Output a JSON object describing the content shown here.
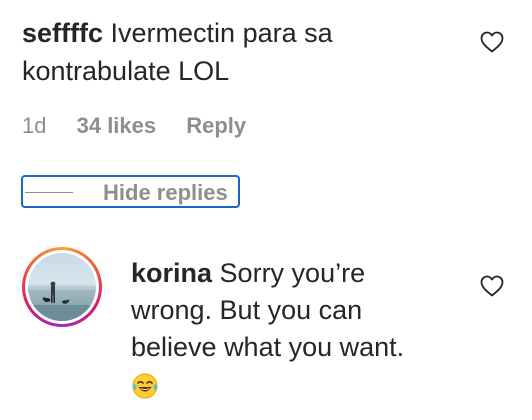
{
  "comment": {
    "username": "seffffc",
    "text": "Ivermectin para sa kontrabulate LOL",
    "time": "1d",
    "likes": "34 likes",
    "reply_label": "Reply"
  },
  "replies_toggle": {
    "label": "Hide replies"
  },
  "reply": {
    "username": "korina",
    "text": "Sorry you’re wrong. But you can believe what you want.",
    "emoji": "😂"
  },
  "icons": {
    "like": "heart-outline-icon",
    "emoji": "tears-of-joy-emoji"
  },
  "colors": {
    "focus_outline": "#1a66c8",
    "muted_text": "#8e8e8e",
    "text": "#262626",
    "story_ring": [
      "#f9a13a",
      "#d3186e",
      "#a12bbd"
    ]
  }
}
